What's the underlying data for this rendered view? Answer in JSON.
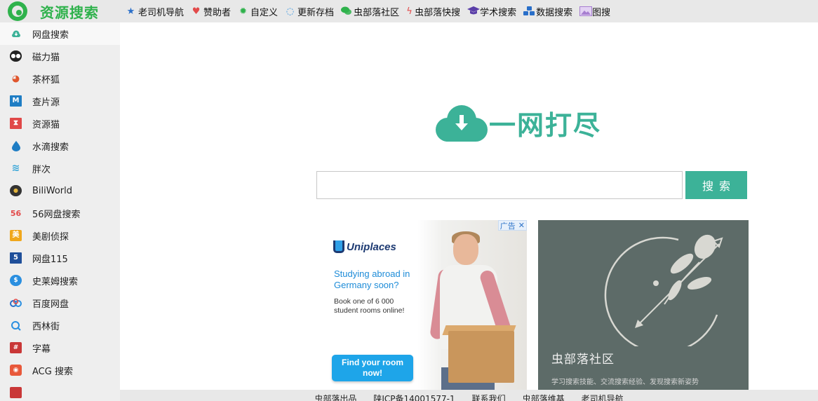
{
  "brand": {
    "name": "资源搜索",
    "color": "#2fb24c"
  },
  "nav": [
    {
      "label": "老司机导航",
      "icon": "star-icon",
      "color": "#2a6fc9"
    },
    {
      "label": "赞助者",
      "icon": "heart-pulse-icon",
      "color": "#e24a4a"
    },
    {
      "label": "自定义",
      "icon": "gear-icon",
      "color": "#2fb24c"
    },
    {
      "label": "更新存档",
      "icon": "refresh-icon",
      "color": "#2a8fe0"
    },
    {
      "label": "虫部落社区",
      "icon": "chat-icon",
      "color": "#2fb24c"
    },
    {
      "label": "虫部落快搜",
      "icon": "lightning-icon",
      "color": "#e24a4a"
    },
    {
      "label": "学术搜索",
      "icon": "graduation-cap-icon",
      "color": "#5a3ea8"
    },
    {
      "label": "数据搜索",
      "icon": "cubes-icon",
      "color": "#2a6fc9"
    },
    {
      "label": "图搜",
      "icon": "image-icon",
      "color": "#a77ed0"
    }
  ],
  "sidebar": {
    "items": [
      {
        "label": "网盘搜索",
        "icon": "cloud-download-icon",
        "active": true
      },
      {
        "label": "磁力猫",
        "icon": "cat-icon"
      },
      {
        "label": "茶杯狐",
        "icon": "fox-icon"
      },
      {
        "label": "查片源",
        "icon": "m-logo-icon"
      },
      {
        "label": "资源猫",
        "icon": "bookmark-icon"
      },
      {
        "label": "水滴搜索",
        "icon": "water-drop-icon"
      },
      {
        "label": "胖次",
        "icon": "wave-icon"
      },
      {
        "label": "BiliWorld",
        "icon": "circle-dot-icon"
      },
      {
        "label": "56网盘搜索",
        "icon": "56-logo-icon"
      },
      {
        "label": "美剧侦探",
        "icon": "mei-logo-icon"
      },
      {
        "label": "网盘115",
        "icon": "five-logo-icon"
      },
      {
        "label": "史莱姆搜索",
        "icon": "dollar-drop-icon"
      },
      {
        "label": "百度网盘",
        "icon": "baidu-cloud-icon"
      },
      {
        "label": "西林街",
        "icon": "search-ring-icon"
      },
      {
        "label": "字幕",
        "icon": "subtitle-logo-icon"
      },
      {
        "label": "ACG 搜索",
        "icon": "acg-face-icon"
      },
      {
        "label": "",
        "icon": "partial-item-icon"
      }
    ]
  },
  "main": {
    "slogan": "一网打尽",
    "accent": "#3cb298",
    "search": {
      "value": "",
      "placeholder": "",
      "button_label": "搜索"
    }
  },
  "ads": {
    "left": {
      "badge": "广告",
      "close": "✕",
      "brand": "Uniplaces",
      "headline": "Studying abroad in Germany soon?",
      "body": "Book one of 6 000 student rooms online!",
      "cta": "Find your room now!"
    },
    "right": {
      "title": "虫部落社区",
      "subtitle": "学习搜索技能、交流搜索经验、发现搜索新姿势"
    }
  },
  "footer": {
    "links": [
      "虫部落出品",
      "陕ICP备14001577-1",
      "联系我们",
      "虫部落维基",
      "老司机导航"
    ]
  }
}
